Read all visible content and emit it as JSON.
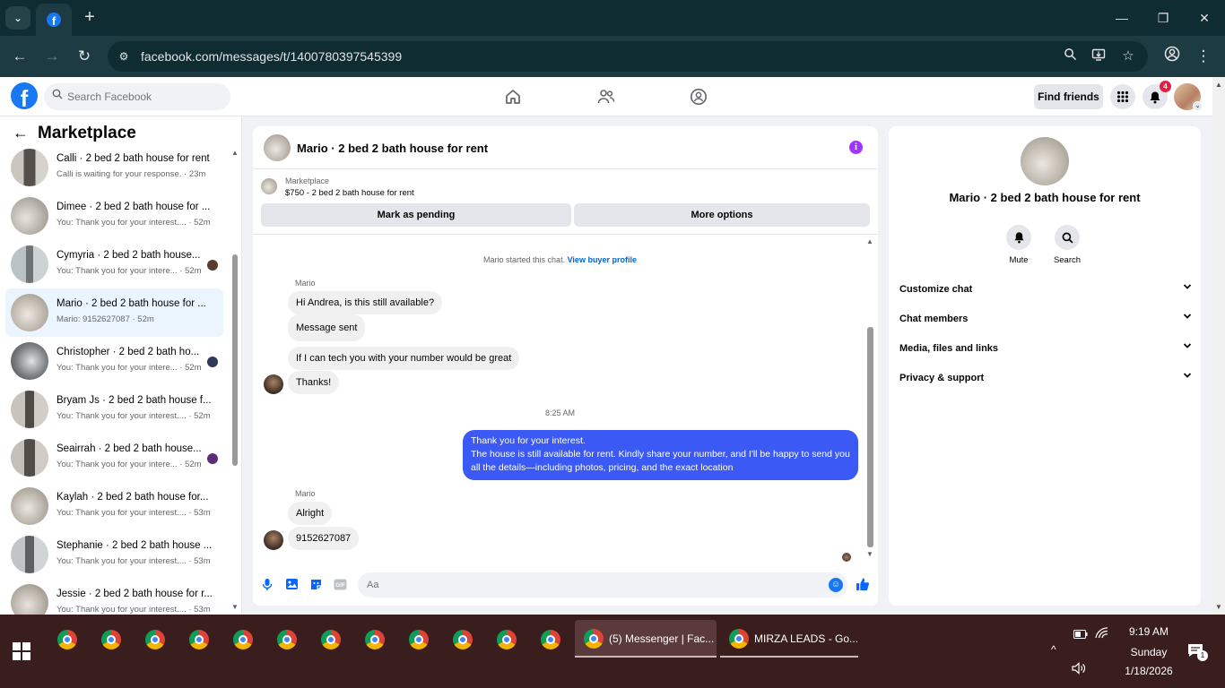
{
  "browser": {
    "url": "facebook.com/messages/t/1400780397545399",
    "new_tab_glyph": "+",
    "tab_icon": "facebook-favicon"
  },
  "header": {
    "search_placeholder": "Search Facebook",
    "find_friends_label": "Find friends",
    "notification_count": "4"
  },
  "sidebar": {
    "title": "Marketplace",
    "conversations": [
      {
        "name": "Calli · 2 bed 2 bath house for rent",
        "preview": "Calli is waiting for your response. · 23m"
      },
      {
        "name": "Dimee · 2 bed 2 bath house for ...",
        "preview": "You: Thank you for your interest.... · 52m"
      },
      {
        "name": "Cymyria · 2 bed 2 bath house...",
        "preview": "You: Thank you for your intere... · 52m"
      },
      {
        "name": "Mario · 2 bed 2 bath house for ...",
        "preview": "Mario: 9152627087 · 52m"
      },
      {
        "name": "Christopher · 2 bed 2 bath ho...",
        "preview": "You: Thank you for your intere... · 52m"
      },
      {
        "name": "Bryam Js · 2 bed 2 bath house f...",
        "preview": "You: Thank you for your interest.... · 52m"
      },
      {
        "name": "Seairrah · 2 bed 2 bath house...",
        "preview": "You: Thank you for your intere... · 52m"
      },
      {
        "name": "Kaylah · 2 bed 2 bath house for...",
        "preview": "You: Thank you for your interest.... · 53m"
      },
      {
        "name": "Stephanie · 2 bed 2 bath house ...",
        "preview": "You: Thank you for your interest.... · 53m"
      },
      {
        "name": "Jessie · 2 bed 2 bath house for r...",
        "preview": "You: Thank you for your interest.... · 53m"
      }
    ]
  },
  "chat": {
    "title": "Mario · 2 bed 2 bath house for rent",
    "listing_label": "Marketplace",
    "listing_price": "$750 - 2 bed 2 bath house for rent",
    "mark_pending_label": "Mark as pending",
    "more_options_label": "More options",
    "started_text": "Mario started this chat.",
    "view_profile_link": "View buyer profile",
    "sender_name": "Mario",
    "incoming_1": [
      "Hi Andrea, is this still available?",
      "Message sent",
      "If I can tech you with your number would be great",
      "Thanks!"
    ],
    "timestamp": "8:25 AM",
    "outgoing": [
      "Thank you for your interest.",
      "The house is still available for rent. Kindly share your number, and I'll be happy to send you all the details—including photos, pricing, and the exact location"
    ],
    "incoming_2": [
      "Alright",
      "9152627087"
    ],
    "input_placeholder": "Aa"
  },
  "info_panel": {
    "title": "Mario · 2 bed 2 bath house for rent",
    "mute_label": "Mute",
    "search_label": "Search",
    "sections": [
      "Customize chat",
      "Chat members",
      "Media, files and links",
      "Privacy & support"
    ]
  },
  "taskbar": {
    "messenger_window": "(5) Messenger | Fac...",
    "leads_window": "MIRZA LEADS - Go...",
    "time": "9:19 AM",
    "day": "Sunday",
    "date": "1/18/2026",
    "notification_count": "1"
  },
  "colors": {
    "facebook_blue": "#1877f2",
    "outgoing_bubble": "#3b59f5",
    "info_icon": "#a033ff",
    "badge_red": "#e41e3f"
  }
}
